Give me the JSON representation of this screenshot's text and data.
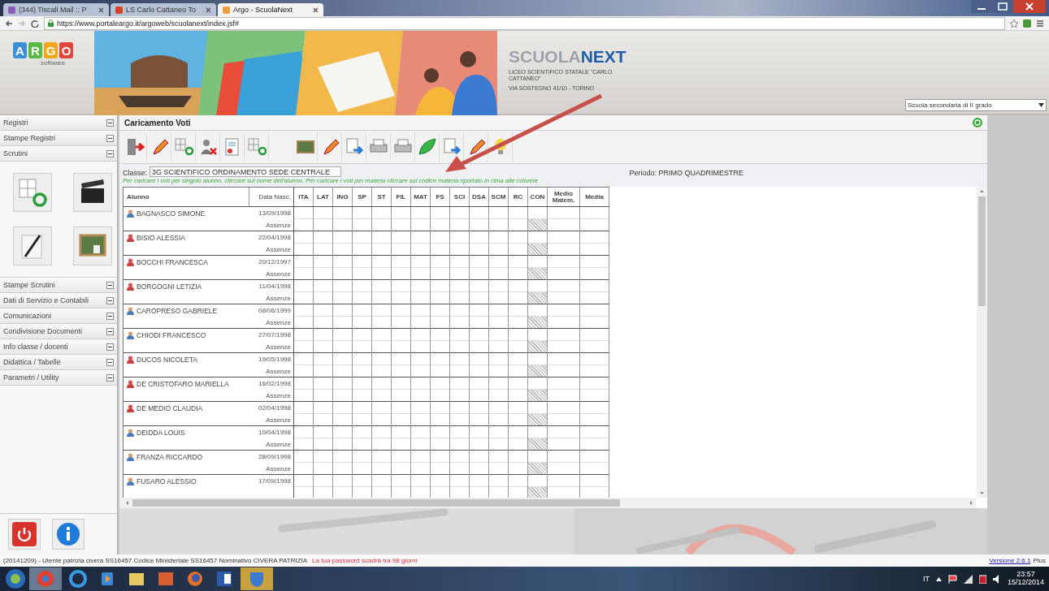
{
  "browser": {
    "tabs": [
      {
        "title": "(344) Tiscali Mail :: P",
        "selected": false
      },
      {
        "title": "LS Carlo Cattaneo To",
        "selected": false
      },
      {
        "title": "Argo - ScuolaNext",
        "selected": true
      }
    ],
    "url": "https://www.portaleargo.it/argoweb/scuolanext/index.jsf#"
  },
  "header": {
    "logo_letters": [
      {
        "text": "A",
        "color": "#3b8ed8"
      },
      {
        "text": "R",
        "color": "#58b947"
      },
      {
        "text": "G",
        "color": "#f2a81d"
      },
      {
        "text": "O",
        "color": "#e0463e"
      }
    ],
    "logo_subtitle": "software",
    "product_name": [
      "SCUOLA",
      "NEXT"
    ],
    "school_name": "LICEO SCIENTIFICO STATALE \"CARLO CATTANEO\"",
    "school_address": "VIA SOSTEGNO 41/10 - TORINO",
    "school_type": "Scuola secondaria di II grado"
  },
  "sidebar": {
    "items": [
      {
        "label": "Registri",
        "kind": "section"
      },
      {
        "label": "Stampe Registri",
        "kind": "section"
      },
      {
        "label": "Scrutini",
        "kind": "section_with_tiles"
      },
      {
        "label": "Stampe Scrutini",
        "kind": "section"
      },
      {
        "label": "Dati di Servizio e Contabili",
        "kind": "section"
      },
      {
        "label": "Comunicazioni",
        "kind": "section"
      },
      {
        "label": "Condivisione Documenti",
        "kind": "section"
      },
      {
        "label": "Info classe / docenti",
        "kind": "section"
      },
      {
        "label": "Didattica / Tabelle",
        "kind": "section"
      },
      {
        "label": "Parametri / Utility",
        "kind": "section"
      }
    ]
  },
  "main": {
    "title": "Caricamento Voti",
    "class_label": "Classe:",
    "class_value": "3G SCIENTIFICO ORDINAMENTO SEDE CENTRALE",
    "period": "Periodo: PRIMO QUADRIMESTRE",
    "hint": "Per caricare i voti per singolo alunno, cliccare sul nome dell'alunno. Per caricare i voti per materia cliccare sul codice materia riportato in cima alle colonne",
    "columns": [
      "Alunno",
      "Data Nasc.",
      "ITA",
      "LAT",
      "ING",
      "SP",
      "ST",
      "FIL",
      "MAT",
      "FS",
      "SCI",
      "DSA",
      "SCM",
      "RC",
      "CON",
      "Medio Matem.",
      "Media"
    ],
    "rows": [
      {
        "name": "BAGNASCO SIMONE",
        "birth_date": "13/09/1998",
        "absences": "Assenze",
        "kind": "male"
      },
      {
        "name": "BISIO ALESSIA",
        "birth_date": "22/04/1998",
        "absences": "Assenze",
        "kind": "female"
      },
      {
        "name": "BOCCHI FRANCESCA",
        "birth_date": "20/12/1997",
        "absences": "Assenze",
        "kind": "female"
      },
      {
        "name": "BORGOGNI LETIZIA",
        "birth_date": "11/04/1998",
        "absences": "Assenze",
        "kind": "female"
      },
      {
        "name": "CAROPRESO GABRIELE",
        "birth_date": "08/06/1999",
        "absences": "Assenze",
        "kind": "male"
      },
      {
        "name": "CHIODI FRANCESCO",
        "birth_date": "27/07/1998",
        "absences": "Assenze",
        "kind": "male"
      },
      {
        "name": "DUCOS NICOLETA",
        "birth_date": "19/05/1998",
        "absences": "Assenze",
        "kind": "female"
      },
      {
        "name": "DE CRISTOFARO MARIELLA",
        "birth_date": "16/02/1998",
        "absences": "Assenze",
        "kind": "female"
      },
      {
        "name": "DE MEDIO CLAUDIA",
        "birth_date": "02/04/1998",
        "absences": "Assenze",
        "kind": "female"
      },
      {
        "name": "DEIDDA LOUIS",
        "birth_date": "10/04/1998",
        "absences": "Assenze",
        "kind": "male"
      },
      {
        "name": "FRANZA RICCARDO",
        "birth_date": "28/09/1998",
        "absences": "Assenze",
        "kind": "male"
      },
      {
        "name": "FUSARO ALESSIO",
        "birth_date": "17/09/1998",
        "kind": "male"
      }
    ]
  },
  "status_bar": {
    "text": "(20141209) - Utente patrizia civera SS16457 Codice Ministeriale SS16457 Nominativo CIVERA PATRIZIA",
    "warning": "La tua password scadrà tra 98 giorni",
    "version_link": "Versione 2.6.1",
    "edition": "Plus"
  },
  "taskbar": {
    "language": "IT",
    "time": "23:57",
    "date": "15/12/2014"
  }
}
